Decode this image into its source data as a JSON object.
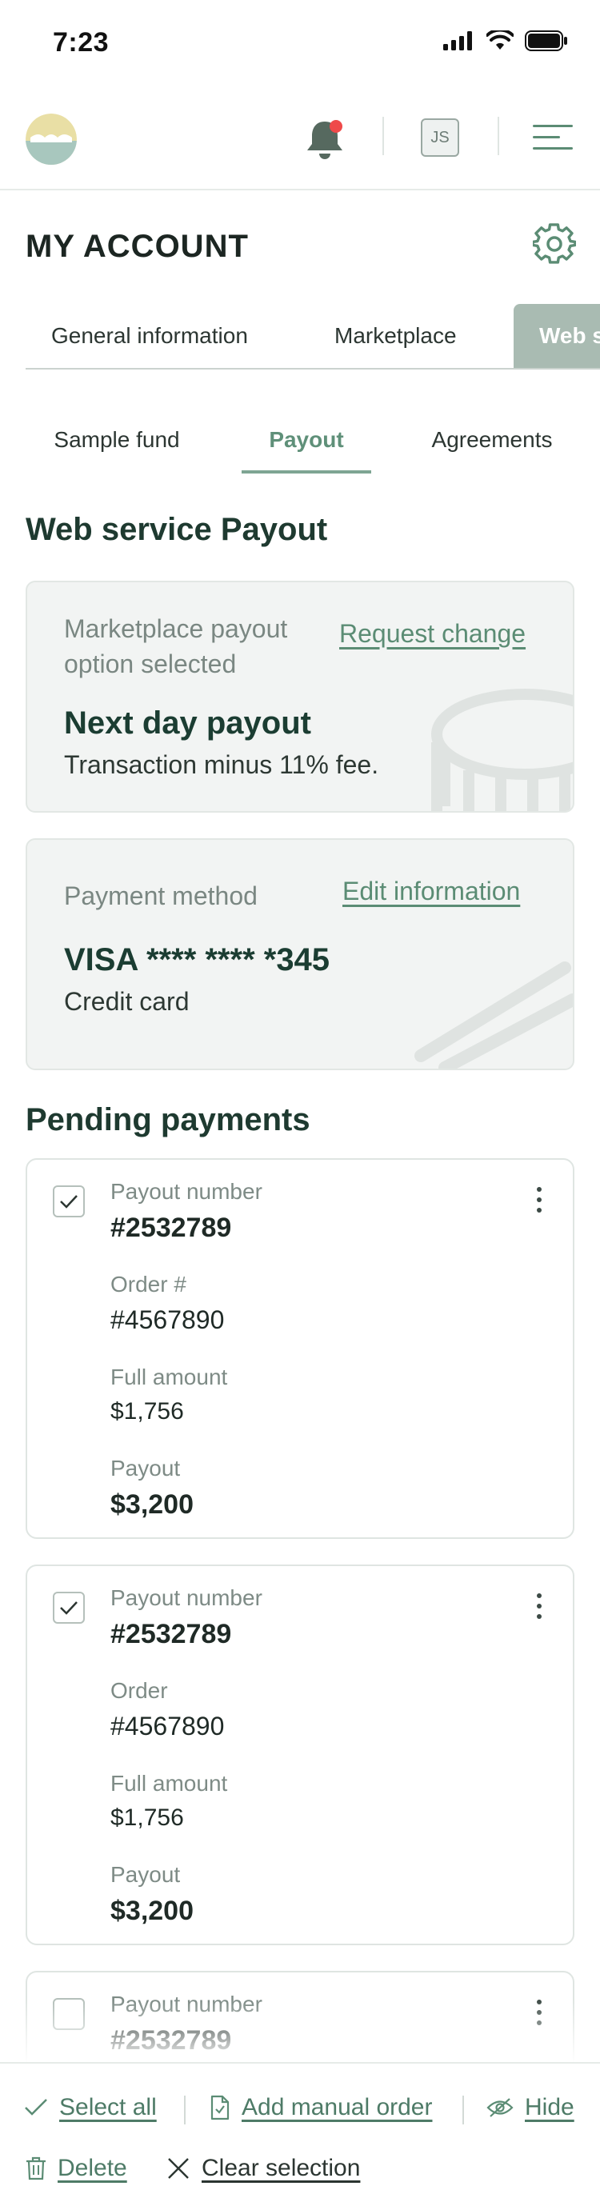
{
  "status_bar": {
    "time": "7:23"
  },
  "header": {
    "avatar_initials": "JS",
    "has_notification": true
  },
  "page": {
    "title": "MY ACCOUNT"
  },
  "top_tabs": [
    {
      "label": "General information",
      "active": false
    },
    {
      "label": "Marketplace",
      "active": false
    },
    {
      "label": "Web s",
      "active": true
    }
  ],
  "sub_tabs": [
    {
      "label": "Sample fund",
      "active": false
    },
    {
      "label": "Payout",
      "active": true
    },
    {
      "label": "Agreements",
      "active": false
    }
  ],
  "payout_section": {
    "title": "Web service Payout",
    "option_card": {
      "label_line1": "Marketplace payout",
      "label_line2": "option selected",
      "link": "Request change",
      "value": "Next day payout",
      "description": "Transaction minus 11% fee."
    },
    "method_card": {
      "label": "Payment method",
      "link": "Edit information",
      "value": "VISA **** **** *345",
      "description": "Credit card"
    }
  },
  "pending": {
    "title": "Pending payments",
    "items": [
      {
        "checked": true,
        "payout_label": "Payout number",
        "payout_number": "#2532789",
        "order_label": "Order #",
        "order_number": "#4567890",
        "full_amount_label": "Full amount",
        "full_amount": "$1,756",
        "payout_amount_label": "Payout",
        "payout_amount": "$3,200"
      },
      {
        "checked": true,
        "payout_label": "Payout number",
        "payout_number": "#2532789",
        "order_label": "Order",
        "order_number": "#4567890",
        "full_amount_label": "Full amount",
        "full_amount": "$1,756",
        "payout_amount_label": "Payout",
        "payout_amount": "$3,200"
      },
      {
        "checked": false,
        "payout_label": "Payout number",
        "payout_number": "#2532789"
      }
    ]
  },
  "actions": {
    "select_all": "Select all",
    "add_manual_order": "Add manual order",
    "hide": "Hide",
    "delete": "Delete",
    "clear_selection": "Clear selection"
  },
  "colors": {
    "accent": "#5b8c74",
    "dark_green": "#1b3d32",
    "active_tab_bg": "#a9bbb2",
    "notification": "#ef4a4a",
    "card_bg": "#f2f4f3"
  },
  "icons": [
    "signal-icon",
    "wifi-icon",
    "battery-icon",
    "bell-icon",
    "menu-icon",
    "gear-icon",
    "check-icon",
    "kebab-icon",
    "document-check-icon",
    "eye-off-icon",
    "trash-icon",
    "close-icon"
  ]
}
